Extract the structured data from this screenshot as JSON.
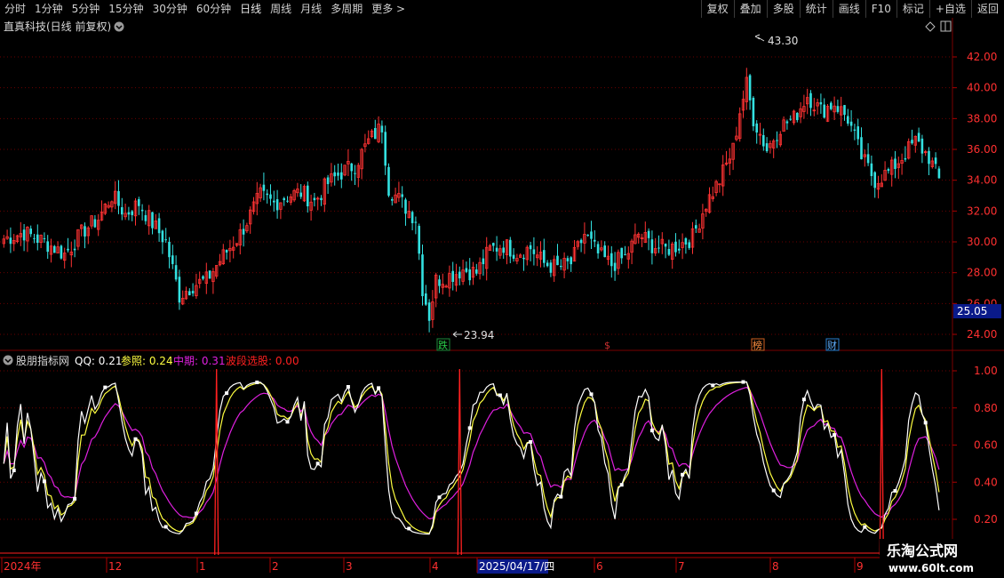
{
  "toolbar": {
    "periods": [
      "分时",
      "1分钟",
      "5分钟",
      "15分钟",
      "30分钟",
      "60分钟",
      "日线",
      "周线",
      "月线",
      "多周期",
      "更多 >"
    ],
    "active": "日线",
    "right": [
      "复权",
      "叠加",
      "多股",
      "统计",
      "画线",
      "F10",
      "标记",
      "+自选",
      "返回"
    ]
  },
  "main_panel": {
    "title": "直真科技(日线 前复权)",
    "price_axis": [
      "42.00",
      "40.00",
      "38.00",
      "36.00",
      "34.00",
      "32.00",
      "30.00",
      "28.00",
      "26.00",
      "24.00"
    ],
    "current_price": "25.05",
    "high_label": "43.30",
    "low_label": "23.94",
    "event_tags": [
      {
        "text": "跌",
        "color": "#1e8a3a"
      },
      {
        "text": "$",
        "color": "#c0282f"
      },
      {
        "text": "榜",
        "color": "#d06020"
      },
      {
        "text": "财",
        "color": "#2a7fd0"
      }
    ]
  },
  "indicator_panel": {
    "name": "股朋指标网",
    "qq_label": "QQ: 0.21",
    "ref_label": "参照: 0.24",
    "mid_label": "中期: 0.31",
    "wave_label": "波段选股: 0.00",
    "axis": [
      "1.00",
      "0.80",
      "0.60",
      "0.40",
      "0.20"
    ]
  },
  "time_axis": {
    "labels": [
      "2024年",
      "12",
      "1",
      "2",
      "3",
      "4",
      "2025/04/17/四",
      "6",
      "7",
      "8",
      "9"
    ]
  },
  "watermark": {
    "line1": "乐淘公式网",
    "line2": "www.60lt.com"
  },
  "colors": {
    "up": "#ff3333",
    "down": "#33e0e0",
    "qq": "#ffffff",
    "ref": "#ffff40",
    "mid": "#e020e0",
    "wave": "#ff2020",
    "grid": "#6a0000"
  },
  "chart_data": {
    "type": "candlestick",
    "title": "直真科技(日线 前复权)",
    "ylim": [
      23.0,
      43.6
    ],
    "high": 43.3,
    "low": 23.94,
    "last": 25.05,
    "close_anchors": [
      {
        "i": 0,
        "v": 30.2
      },
      {
        "i": 6,
        "v": 30.6
      },
      {
        "i": 12,
        "v": 30.0
      },
      {
        "i": 18,
        "v": 29.2
      },
      {
        "i": 24,
        "v": 30.8
      },
      {
        "i": 28,
        "v": 31.5
      },
      {
        "i": 32,
        "v": 33.0
      },
      {
        "i": 36,
        "v": 31.8
      },
      {
        "i": 40,
        "v": 32.5
      },
      {
        "i": 44,
        "v": 31.2
      },
      {
        "i": 48,
        "v": 30.0
      },
      {
        "i": 52,
        "v": 26.5
      },
      {
        "i": 56,
        "v": 27.2
      },
      {
        "i": 60,
        "v": 27.5
      },
      {
        "i": 64,
        "v": 28.8
      },
      {
        "i": 70,
        "v": 30.5
      },
      {
        "i": 76,
        "v": 33.0
      },
      {
        "i": 80,
        "v": 32.5
      },
      {
        "i": 84,
        "v": 33.0
      },
      {
        "i": 88,
        "v": 33.2
      },
      {
        "i": 92,
        "v": 32.6
      },
      {
        "i": 96,
        "v": 33.8
      },
      {
        "i": 100,
        "v": 34.5
      },
      {
        "i": 104,
        "v": 35.0
      },
      {
        "i": 108,
        "v": 36.5
      },
      {
        "i": 112,
        "v": 37.5
      },
      {
        "i": 114,
        "v": 33.5
      },
      {
        "i": 118,
        "v": 32.5
      },
      {
        "i": 122,
        "v": 31.5
      },
      {
        "i": 124,
        "v": 27.0
      },
      {
        "i": 126,
        "v": 25.2
      },
      {
        "i": 128,
        "v": 27.5
      },
      {
        "i": 132,
        "v": 27.8
      },
      {
        "i": 136,
        "v": 28.2
      },
      {
        "i": 140,
        "v": 28.0
      },
      {
        "i": 144,
        "v": 29.5
      },
      {
        "i": 148,
        "v": 29.8
      },
      {
        "i": 152,
        "v": 29.3
      },
      {
        "i": 156,
        "v": 29.6
      },
      {
        "i": 160,
        "v": 28.6
      },
      {
        "i": 164,
        "v": 28.3
      },
      {
        "i": 168,
        "v": 28.6
      },
      {
        "i": 172,
        "v": 30.5
      },
      {
        "i": 176,
        "v": 29.2
      },
      {
        "i": 180,
        "v": 28.5
      },
      {
        "i": 184,
        "v": 29.0
      },
      {
        "i": 188,
        "v": 30.5
      },
      {
        "i": 192,
        "v": 29.8
      },
      {
        "i": 196,
        "v": 29.5
      },
      {
        "i": 200,
        "v": 29.8
      },
      {
        "i": 204,
        "v": 30.3
      },
      {
        "i": 208,
        "v": 32.5
      },
      {
        "i": 212,
        "v": 34.0
      },
      {
        "i": 216,
        "v": 36.0
      },
      {
        "i": 218,
        "v": 38.5
      },
      {
        "i": 220,
        "v": 40.2
      },
      {
        "i": 222,
        "v": 38.0
      },
      {
        "i": 226,
        "v": 36.0
      },
      {
        "i": 230,
        "v": 37.5
      },
      {
        "i": 234,
        "v": 38.0
      },
      {
        "i": 238,
        "v": 39.5
      },
      {
        "i": 242,
        "v": 38.5
      },
      {
        "i": 246,
        "v": 39.0
      },
      {
        "i": 250,
        "v": 38.0
      },
      {
        "i": 254,
        "v": 35.5
      },
      {
        "i": 258,
        "v": 34.0
      },
      {
        "i": 262,
        "v": 34.5
      },
      {
        "i": 266,
        "v": 35.5
      },
      {
        "i": 270,
        "v": 36.5
      },
      {
        "i": 274,
        "v": 35.5
      },
      {
        "i": 277,
        "v": 34.0
      }
    ]
  }
}
